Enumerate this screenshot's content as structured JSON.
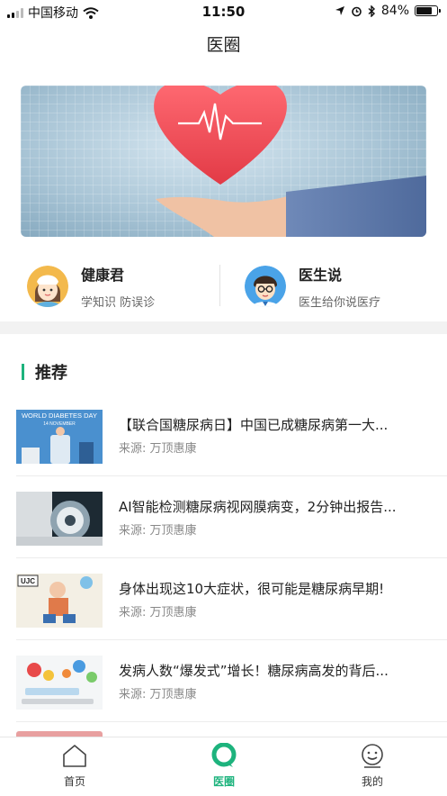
{
  "status_bar": {
    "carrier": "中国移动",
    "time": "11:50",
    "battery": "84%",
    "battery_level": 0.84
  },
  "nav": {
    "title": "医圈"
  },
  "banner": {
    "image": "heart-in-hand-ecg-illustration",
    "page_count": 2,
    "active_page": 1
  },
  "channels": [
    {
      "title": "健康君",
      "subtitle": "学知识 防误诊",
      "icon": "nurse-avatar-icon"
    },
    {
      "title": "医生说",
      "subtitle": "医生给你说医疗",
      "icon": "doctor-avatar-icon"
    }
  ],
  "section": {
    "title": "推荐"
  },
  "articles": [
    {
      "title": "【联合国糖尿病日】中国已成糖尿病第一大...",
      "source": "来源: 万顶惠康",
      "thumb_text": "WORLD DIABETES DAY",
      "thumb_sub": "14 NOVEMBER"
    },
    {
      "title": "AI智能检测糖尿病视网膜病变，2分钟出报告...",
      "source": "来源: 万顶惠康"
    },
    {
      "title": "身体出现这10大症状，很可能是糖尿病早期!",
      "source": "来源: 万顶惠康",
      "thumb_text": "UJC"
    },
    {
      "title": "发病人数“爆发式”增长！糖尿病高发的背后...",
      "source": "来源: 万顶惠康"
    }
  ],
  "tabbar": {
    "items": [
      {
        "label": "首页",
        "icon": "home-icon"
      },
      {
        "label": "医圈",
        "icon": "circle-bubble-icon",
        "active": true
      },
      {
        "label": "我的",
        "icon": "profile-icon"
      }
    ]
  },
  "colors": {
    "accent": "#1db37d",
    "heart": "#e8424c"
  }
}
